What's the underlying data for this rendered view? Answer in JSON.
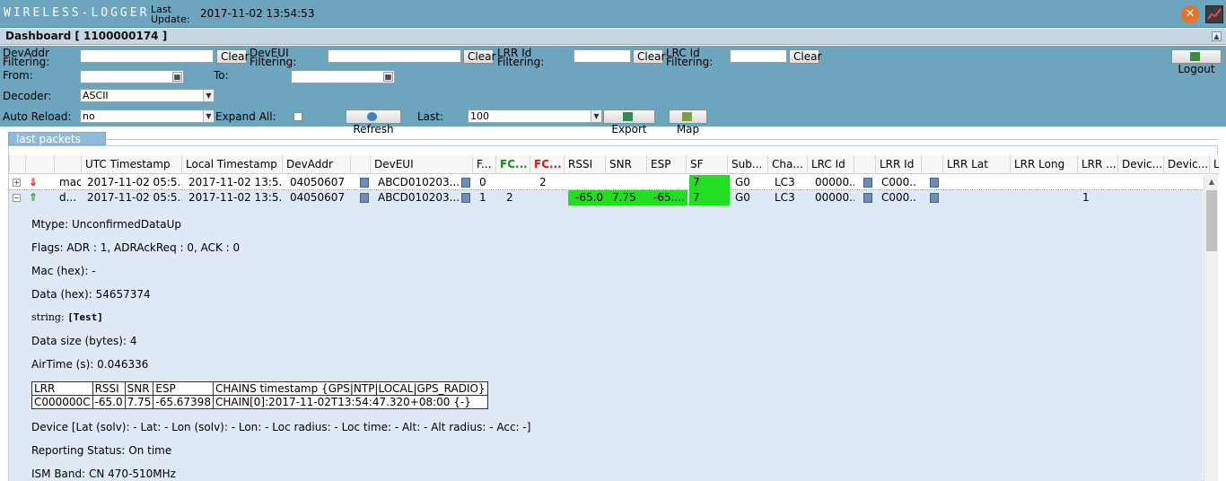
{
  "header": {
    "brand": "WIRELESS-LOGGER",
    "last_update_label": "Last Update:",
    "last_update_value": "2017-11-02 13:54:53"
  },
  "dashboard": {
    "title": "Dashboard [ 1100000174 ]"
  },
  "filters": {
    "devaddr_label": "DevAddr Filtering:",
    "deveui_label": "DevEUI Filtering:",
    "lrr_label": "LRR Id Filtering:",
    "lrc_label": "LRC Id Filtering:",
    "clear": "Clear",
    "logout": "Logout",
    "from_label": "From:",
    "to_label": "To:",
    "decoder_label": "Decoder:",
    "decoder_value": "ASCII",
    "auto_reload_label": "Auto Reload:",
    "auto_reload_value": "no",
    "expand_all_label": "Expand All:",
    "refresh": "Refresh",
    "last_label": "Last:",
    "last_value": "100",
    "export": "Export",
    "map": "Map"
  },
  "panel": {
    "tab": "last packets"
  },
  "table": {
    "headers": [
      "UTC Timestamp",
      "Local Timestamp",
      "DevAddr",
      "DevEUI",
      "F...",
      "FC...",
      "FC...",
      "RSSI",
      "SNR",
      "ESP",
      "SF",
      "Sub...",
      "Cha...",
      "LRC Id",
      "LRR Id",
      "LRR Lat",
      "LRR Long",
      "LRR ...",
      "Devic...",
      "Devic...",
      "L"
    ],
    "rows": [
      {
        "type": "mac",
        "utc": "2017-11-02 05:5...",
        "local": "2017-11-02 13:5...",
        "devaddr": "04050607",
        "deveui": "ABCD010203...",
        "f": "0",
        "fcup": "",
        "fcdn": "2",
        "rssi": "",
        "snr": "",
        "esp": "",
        "sf": "7",
        "sub": "G0",
        "chan": "LC3",
        "lrc": "00000...",
        "lrr": "C000...",
        "lrr_extra": ""
      },
      {
        "type": "d...",
        "utc": "2017-11-02 05:5...",
        "local": "2017-11-02 13:5...",
        "devaddr": "04050607",
        "deveui": "ABCD010203...",
        "f": "1",
        "fcup": "2",
        "fcdn": "",
        "rssi": "-65.0",
        "snr": "7.75",
        "esp": "-65....",
        "sf": "7",
        "sub": "G0",
        "chan": "LC3",
        "lrc": "00000...",
        "lrr": "C000...",
        "lrr_extra": "1"
      }
    ]
  },
  "details": {
    "mtype": "Mtype: UnconfirmedDataUp",
    "flags": "Flags: ADR : 1, ADRAckReq : 0, ACK : 0",
    "mac_hex": "Mac (hex): -",
    "data_hex": "Data (hex): 54657374",
    "string_label": "string:",
    "string_value": "[Test]",
    "data_size": "Data size (bytes): 4",
    "airtime": "AirTime (s): 0.046336",
    "lrr_table": {
      "headers": [
        "LRR",
        "RSSI",
        "SNR",
        "ESP",
        "CHAINS timestamp {GPS|NTP|LOCAL|GPS_RADIO}"
      ],
      "row": [
        "C000000C",
        "-65.0",
        "7.75",
        "-65.67398",
        "CHAIN[0]:2017-11-02T13:54:47.320+08:00 {-}"
      ]
    },
    "device": "Device [Lat (solv): - Lat: - Lon (solv): - Lon: - Loc radius: - Loc time: - Alt: - Alt radius: - Acc: -]",
    "reporting": "Reporting Status: On time",
    "ism": "ISM Band: CN 470-510MHz"
  }
}
